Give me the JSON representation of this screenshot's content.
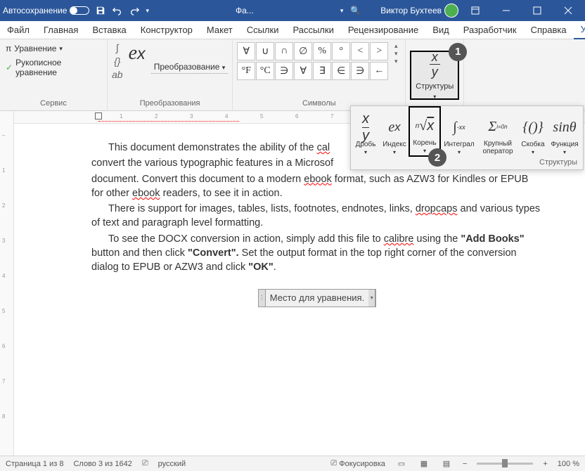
{
  "titlebar": {
    "autosave": "Автосохранение",
    "filename": "Фа...",
    "search_icon": "🔍",
    "user": "Виктор Бухтеев"
  },
  "tabs": {
    "file": "Файл",
    "home": "Главная",
    "insert": "Вставка",
    "design": "Конструктор",
    "layout": "Макет",
    "references": "Ссылки",
    "mailings": "Рассылки",
    "review": "Рецензирование",
    "view": "Вид",
    "developer": "Разработчик",
    "help": "Справка",
    "equation": "Уравнение"
  },
  "ribbon": {
    "service": {
      "equation": "Уравнение",
      "ink": "Рукописное уравнение",
      "label": "Сервис"
    },
    "transform": {
      "label_btn": "Преобразование",
      "label": "Преобразования"
    },
    "symbols": {
      "row1": [
        "∀",
        "∪",
        "∩",
        "∅",
        "%",
        "°",
        "<",
        ">"
      ],
      "row2": [
        "°F",
        "°C",
        "∋",
        "∀",
        "∃",
        "∈",
        "∋",
        "←"
      ],
      "label": "Символы"
    },
    "structures": {
      "label": "Структуры"
    }
  },
  "flyout": {
    "fraction": "Дробь",
    "index": "Индекс",
    "root": "Корень",
    "integral": "Интеграл",
    "bigop": "Крупный оператор",
    "bracket": "Скобка",
    "function": "Функция",
    "footer": "Структуры"
  },
  "document": {
    "p1a": "This document demonstrates the ability of the ",
    "p1a_u": "cal",
    "p1b": "convert the various typographic features in a Microsof",
    "p1c": "document. Convert this document to a modern ",
    "p1c_u": "ebook",
    "p1d": " format, such as AZW3 for Kindles or EPUB for other ",
    "p1d_u": "ebook",
    "p1e": " readers, to see it in action.",
    "p2a": "There is support for images, tables, lists, footnotes, endnotes, links, ",
    "p2a_u": "dropcaps",
    "p2b": " and various types of text and paragraph level formatting.",
    "p3a": "To see the DOCX conversion in action, simply add this file to ",
    "p3a_u": "calibre",
    "p3b": " using the ",
    "p3c": "\"Add Books\"",
    "p3d": " button and then click ",
    "p3e": "\"Convert\".",
    "p3f": "  Set the output format in the top right corner of the conversion dialog to EPUB or AZW3 and click ",
    "p3g": "\"OK\"",
    "p3h": ".",
    "eq_placeholder": "Место для уравнения."
  },
  "statusbar": {
    "page": "Страница 1 из 8",
    "words": "Слово 3 из 1642",
    "lang": "русский",
    "focus": "Фокусировка",
    "zoom": "100 %"
  },
  "callouts": {
    "one": "1",
    "two": "2"
  }
}
